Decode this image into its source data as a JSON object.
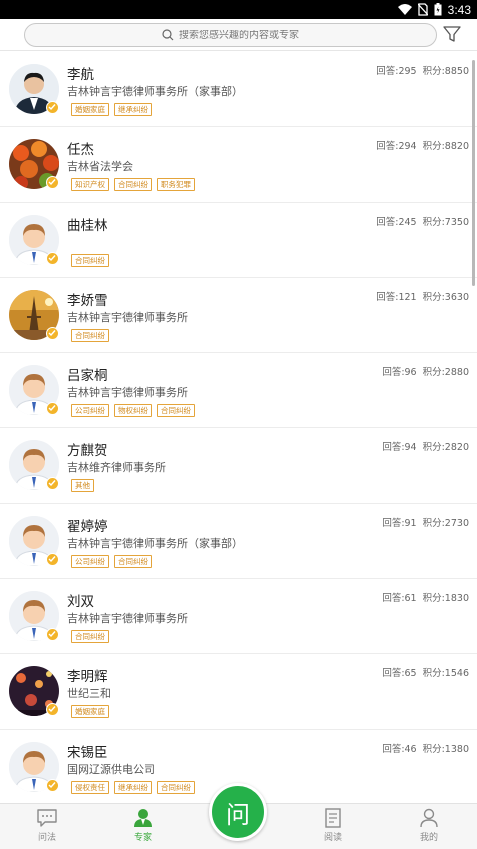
{
  "status_bar": {
    "time": "3:43",
    "icons": [
      "wifi-icon",
      "no-sim-icon",
      "battery-icon"
    ]
  },
  "search": {
    "placeholder": "搜索您感兴趣的内容或专家"
  },
  "experts": [
    {
      "name": "李航",
      "org": "吉林钟言宇德律师事务所（家事部）",
      "tags": [
        "婚姻家庭",
        "继承纠纷"
      ],
      "answers_label": "回答:295",
      "points_label": "积分:8850",
      "avatar": "photo-man"
    },
    {
      "name": "任杰",
      "org": "吉林省法学会",
      "tags": [
        "知识产权",
        "合同纠纷",
        "职务犯罪"
      ],
      "answers_label": "回答:294",
      "points_label": "积分:8820",
      "avatar": "photo-food"
    },
    {
      "name": "曲桂林",
      "org": "",
      "tags": [
        "合同纠纷"
      ],
      "answers_label": "回答:245",
      "points_label": "积分:7350",
      "avatar": "default"
    },
    {
      "name": "李娇雪",
      "org": "吉林钟言宇德律师事务所",
      "tags": [
        "合同纠纷"
      ],
      "answers_label": "回答:121",
      "points_label": "积分:3630",
      "avatar": "photo-tower"
    },
    {
      "name": "吕家桐",
      "org": "吉林钟言宇德律师事务所",
      "tags": [
        "公司纠纷",
        "物权纠纷",
        "合同纠纷"
      ],
      "answers_label": "回答:96",
      "points_label": "积分:2880",
      "avatar": "default"
    },
    {
      "name": "方麒贺",
      "org": "吉林维齐律师事务所",
      "tags": [
        "其他"
      ],
      "answers_label": "回答:94",
      "points_label": "积分:2820",
      "avatar": "default"
    },
    {
      "name": "翟婷婷",
      "org": "吉林钟言宇德律师事务所（家事部）",
      "tags": [
        "公司纠纷",
        "合同纠纷"
      ],
      "answers_label": "回答:91",
      "points_label": "积分:2730",
      "avatar": "default"
    },
    {
      "name": "刘双",
      "org": "吉林钟言宇德律师事务所",
      "tags": [
        "合同纠纷"
      ],
      "answers_label": "回答:61",
      "points_label": "积分:1830",
      "avatar": "default"
    },
    {
      "name": "李明辉",
      "org": "世纪三和",
      "tags": [
        "婚姻家庭"
      ],
      "answers_label": "回答:65",
      "points_label": "积分:1546",
      "avatar": "photo-night"
    },
    {
      "name": "宋锡臣",
      "org": "国网辽源供电公司",
      "tags": [
        "侵权责任",
        "继承纠纷",
        "合同纠纷"
      ],
      "answers_label": "回答:46",
      "points_label": "积分:1380",
      "avatar": "default"
    }
  ],
  "nav": {
    "items": [
      {
        "label": "问法",
        "icon": "chat-icon"
      },
      {
        "label": "专家",
        "icon": "expert-icon",
        "active": true
      },
      {
        "label": "阅读",
        "icon": "document-icon"
      },
      {
        "label": "我的",
        "icon": "person-icon"
      }
    ],
    "ask_label": "问"
  },
  "colors": {
    "accent": "#25b14a",
    "tag": "#d18a1e",
    "badge": "#f3b42a"
  }
}
